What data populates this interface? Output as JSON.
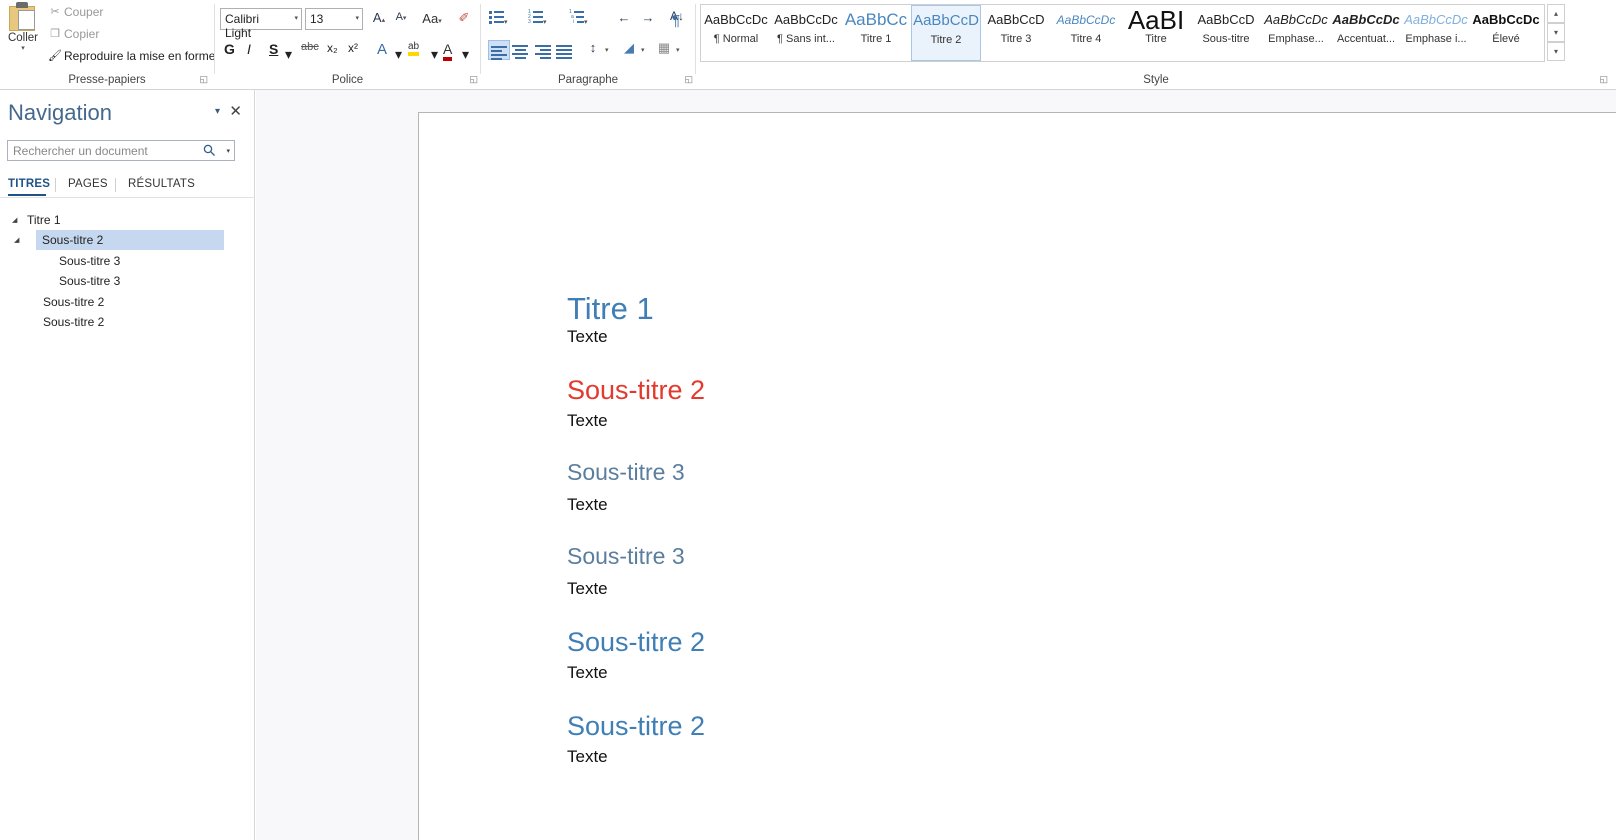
{
  "ribbon": {
    "clipboard": {
      "group_label": "Presse-papiers",
      "paste_label": "Coller",
      "paste_arrow": "▾",
      "items": [
        {
          "icon": "✂",
          "label": "Couper",
          "icon_name": "cut-icon"
        },
        {
          "icon": "❐",
          "label": "Copier",
          "icon_name": "copy-icon"
        },
        {
          "icon": "🖌",
          "label": "Reproduire la mise en forme",
          "icon_name": "format-painter-icon"
        }
      ]
    },
    "font": {
      "group_label": "Police",
      "font_name": "Calibri Light",
      "font_size": "13",
      "grow_label": "A",
      "shrink_label": "A",
      "case_label": "Aa",
      "clear_format_label": "✐",
      "bold": "G",
      "italic": "I",
      "underline": "S",
      "strike": "abc",
      "subscript": "x₂",
      "superscript": "x²",
      "text_effects": "A",
      "highlight": "ab",
      "font_color": "A"
    },
    "paragraph": {
      "group_label": "Paragraphe",
      "bullets_name": "bullet-list-icon",
      "numbering_name": "numbered-list-icon",
      "multilevel_name": "multilevel-list-icon",
      "decrease_indent": "←",
      "increase_indent": "→",
      "sort_label": "A↓",
      "align_left_name": "align-left-icon",
      "align_center_name": "align-center-icon",
      "align_right_name": "align-right-icon",
      "justify_name": "align-justify-icon",
      "line_spacing": "↕",
      "shading": "◢",
      "borders": "▦"
    },
    "styles": {
      "group_label": "Style",
      "selected": "Titre 2",
      "items": [
        {
          "preview": "AaBbCcDc",
          "name": "¶ Normal",
          "color": "#222222",
          "italic": false,
          "bold": false,
          "size": 13
        },
        {
          "preview": "AaBbCcDc",
          "name": "¶ Sans int...",
          "color": "#222222",
          "italic": false,
          "bold": false,
          "size": 13
        },
        {
          "preview": "AaBbCс",
          "name": "Titre 1",
          "color": "#4a87c0",
          "italic": false,
          "bold": false,
          "size": 17
        },
        {
          "preview": "AaBbCcD",
          "name": "Titre 2",
          "color": "#4a87c0",
          "italic": false,
          "bold": false,
          "size": 15
        },
        {
          "preview": "AaBbCcD",
          "name": "Titre 3",
          "color": "#222222",
          "italic": false,
          "bold": false,
          "size": 13
        },
        {
          "preview": "AaBbCcDc",
          "name": "Titre 4",
          "color": "#4a87c0",
          "italic": true,
          "bold": false,
          "size": 12
        },
        {
          "preview": "AaBІ",
          "name": "Titre",
          "color": "#111111",
          "italic": false,
          "bold": false,
          "size": 26
        },
        {
          "preview": "AaBbCcD",
          "name": "Sous-titre",
          "color": "#222222",
          "italic": false,
          "bold": false,
          "size": 13
        },
        {
          "preview": "AaBbCcDc",
          "name": "Emphase...",
          "color": "#222222",
          "italic": true,
          "bold": false,
          "size": 13
        },
        {
          "preview": "AaBbCcDc",
          "name": "Accentuat...",
          "color": "#222222",
          "italic": true,
          "bold": true,
          "size": 13
        },
        {
          "preview": "AaBbCcDc",
          "name": "Emphase i...",
          "color": "#7fb0de",
          "italic": true,
          "bold": false,
          "size": 13
        },
        {
          "preview": "AaBbCcDc",
          "name": "Élevé",
          "color": "#111111",
          "italic": false,
          "bold": true,
          "size": 13
        }
      ],
      "scroll_up": "▴",
      "scroll_down": "▾",
      "scroll_more": "▾"
    },
    "launcher_glyph": "◱"
  },
  "navigation": {
    "title": "Navigation",
    "collapse_glyph": "▾",
    "close_glyph": "✕",
    "search_placeholder": "Rechercher un document",
    "search_value": "",
    "search_icon_glyph": "🔍",
    "search_dropdown_glyph": "▾",
    "tabs": [
      {
        "label": "TITRES",
        "active": true
      },
      {
        "label": "PAGES",
        "active": false
      },
      {
        "label": "RÉSULTATS",
        "active": false
      }
    ],
    "tree": [
      {
        "label": "Titre 1",
        "level": 0,
        "expanded": true,
        "selected": false
      },
      {
        "label": "Sous-titre 2",
        "level": 1,
        "expanded": true,
        "selected": true
      },
      {
        "label": "Sous-titre 3",
        "level": 2,
        "expanded": false,
        "selected": false
      },
      {
        "label": "Sous-titre 3",
        "level": 2,
        "expanded": false,
        "selected": false
      },
      {
        "label": "Sous-titre 2",
        "level": 1,
        "expanded": false,
        "selected": false
      },
      {
        "label": "Sous-titre 2",
        "level": 1,
        "expanded": false,
        "selected": false
      }
    ]
  },
  "document": {
    "blocks": [
      {
        "text": "Titre 1",
        "style": "h1",
        "color_name": "blue"
      },
      {
        "text": "Texte",
        "style": "body",
        "color_name": "black"
      },
      {
        "text": "Sous-titre 2",
        "style": "h2",
        "color_name": "red"
      },
      {
        "text": "Texte",
        "style": "body",
        "color_name": "black"
      },
      {
        "text": "Sous-titre 3",
        "style": "h3",
        "color_name": "steel"
      },
      {
        "text": "Texte",
        "style": "body",
        "color_name": "black"
      },
      {
        "text": "Sous-titre 3",
        "style": "h3",
        "color_name": "steel"
      },
      {
        "text": "Texte",
        "style": "body",
        "color_name": "black"
      },
      {
        "text": "Sous-titre 2",
        "style": "h2",
        "color_name": "blue"
      },
      {
        "text": "Texte",
        "style": "body",
        "color_name": "black"
      },
      {
        "text": "Sous-titre 2",
        "style": "h2",
        "color_name": "blue"
      },
      {
        "text": "Texte",
        "style": "body",
        "color_name": "black"
      }
    ]
  },
  "colors": {
    "heading_blue": "#3f7fb5",
    "heading_red": "#e23b2e",
    "heading_steel": "#5b7e9e",
    "nav_title_blue": "#44688e",
    "selection_blue": "#c5d8ef",
    "accent_tab_blue": "#1f5288"
  }
}
